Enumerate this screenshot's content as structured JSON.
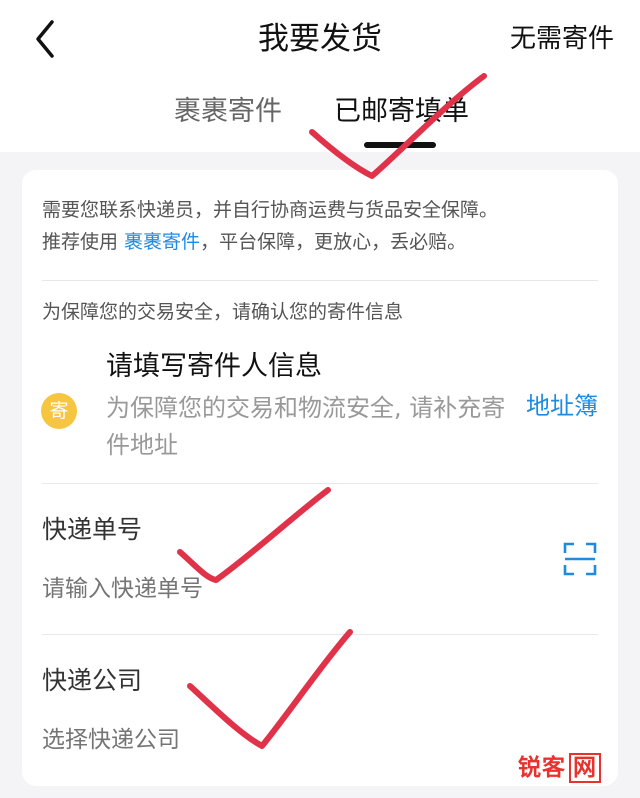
{
  "header": {
    "title": "我要发货",
    "right_action": "无需寄件",
    "tabs": [
      {
        "label": "裹裹寄件",
        "active": false
      },
      {
        "label": "已邮寄填单",
        "active": true
      }
    ]
  },
  "notice": {
    "line1": "需要您联系快递员，并自行协商运费与货品安全保障。",
    "line2_prefix": "推荐使用 ",
    "line2_link": "裹裹寄件",
    "line2_suffix": "，平台保障，更放心，丢必赔。"
  },
  "confirm_text": "为保障您的交易安全，请确认您的寄件信息",
  "sender": {
    "badge": "寄",
    "title": "请填写寄件人信息",
    "hint": "为保障您的交易和物流安全, 请补充寄件地址",
    "address_book": "地址簿"
  },
  "tracking": {
    "label": "快递单号",
    "placeholder": "请输入快递单号"
  },
  "courier": {
    "label": "快递公司",
    "placeholder": "选择快递公司"
  },
  "watermark": {
    "text1": "锐客",
    "text2": "网"
  },
  "colors": {
    "accent_blue": "#1f8be0",
    "badge_yellow": "#f6c641",
    "check_red": "#e0334a",
    "watermark_red": "#e9322d"
  }
}
